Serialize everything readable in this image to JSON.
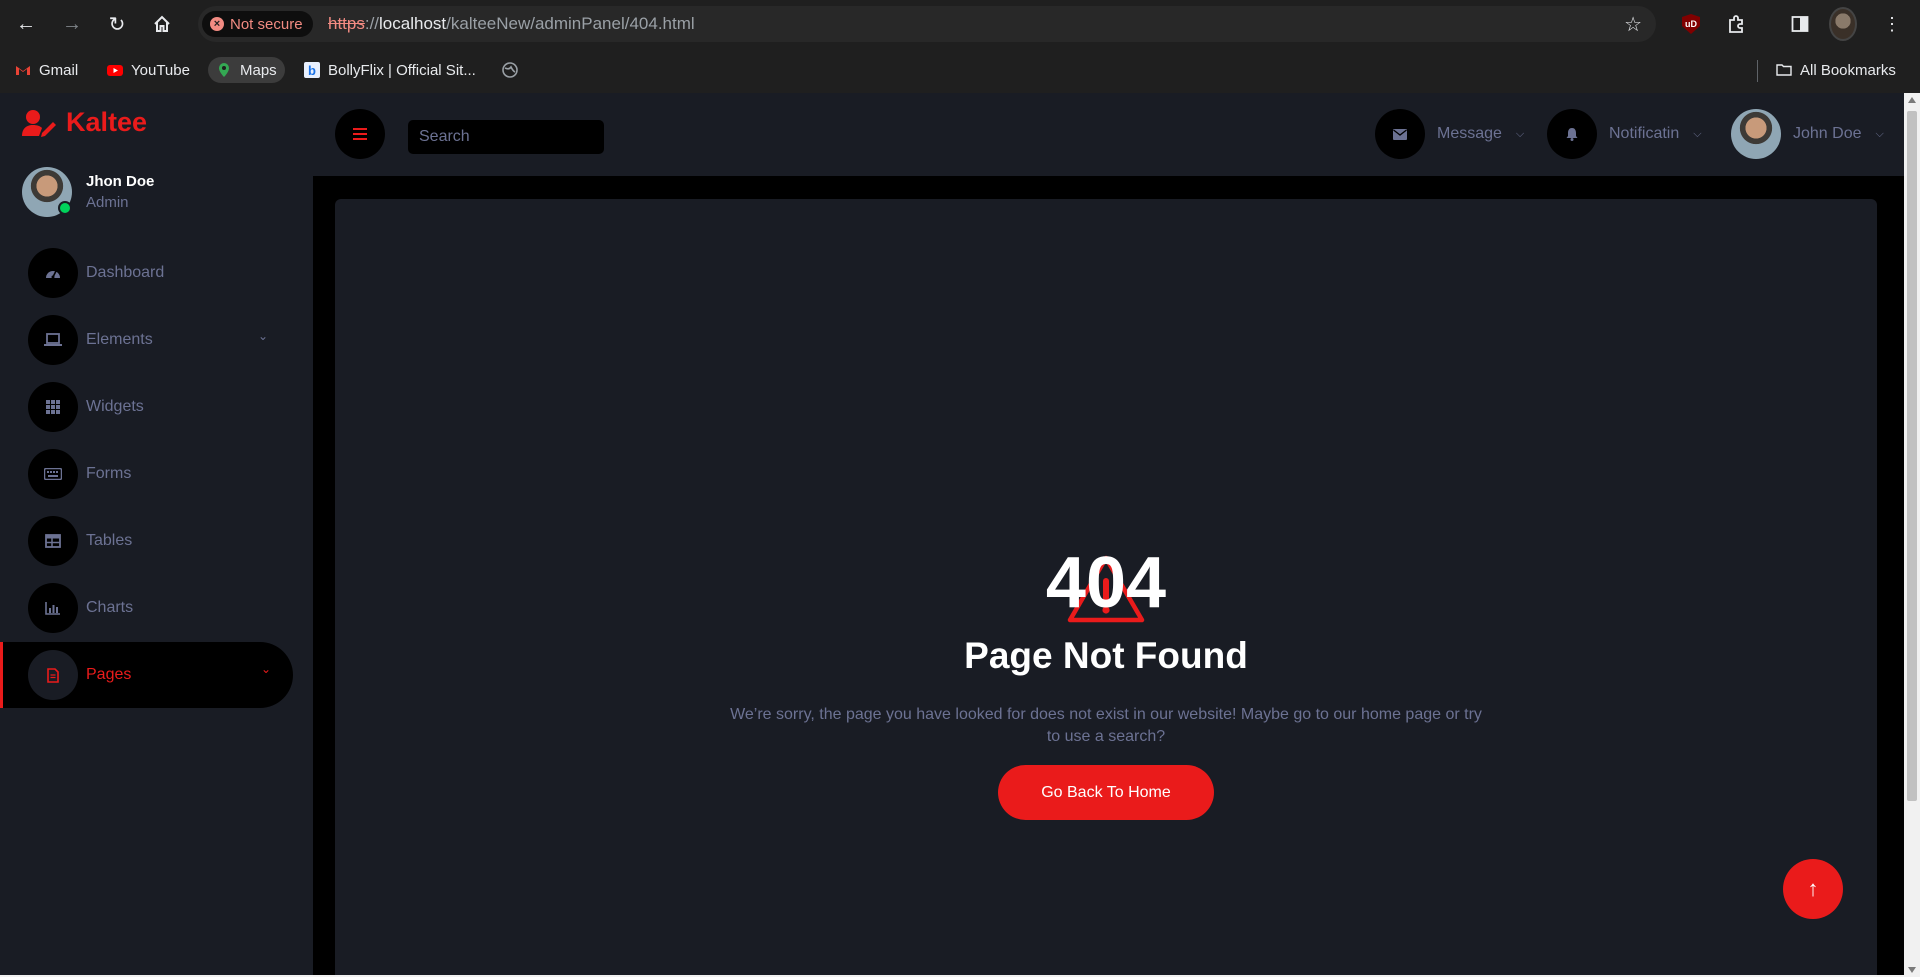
{
  "browser": {
    "security_label": "Not secure",
    "url_scheme": "https",
    "url_sep": "://",
    "url_host": "localhost",
    "url_path": "/kalteeNew/adminPanel/404.html",
    "bookmarks": [
      {
        "label": "Gmail",
        "icon": "gmail-icon"
      },
      {
        "label": "YouTube",
        "icon": "youtube-icon"
      },
      {
        "label": "Maps",
        "icon": "maps-icon"
      },
      {
        "label": "BollyFlix | Official Sit...",
        "icon": "bollyflix-icon"
      }
    ],
    "all_bookmarks_label": "All Bookmarks"
  },
  "sidebar": {
    "brand": "Kaltee",
    "user_name": "Jhon Doe",
    "user_role": "Admin",
    "items": [
      {
        "label": "Dashboard",
        "icon": "dashboard-icon"
      },
      {
        "label": "Elements",
        "icon": "laptop-icon",
        "has_submenu": true
      },
      {
        "label": "Widgets",
        "icon": "grid-icon"
      },
      {
        "label": "Forms",
        "icon": "keyboard-icon"
      },
      {
        "label": "Tables",
        "icon": "table-icon"
      },
      {
        "label": "Charts",
        "icon": "chart-icon"
      },
      {
        "label": "Pages",
        "icon": "file-icon",
        "has_submenu": true,
        "active": true
      }
    ]
  },
  "topbar": {
    "search_placeholder": "Search",
    "message_label": "Message",
    "notification_label": "Notificatin",
    "user_label": "John Doe"
  },
  "error": {
    "code": "404",
    "title": "Page Not Found",
    "description": "We’re sorry, the page you have looked for does not exist in our website! Maybe go to our home page or try to use a search?",
    "button_label": "Go Back To Home"
  },
  "colors": {
    "accent": "#ea1b1b",
    "panel": "#191c24",
    "muted_text": "#6c7293",
    "online": "#00d25b"
  }
}
